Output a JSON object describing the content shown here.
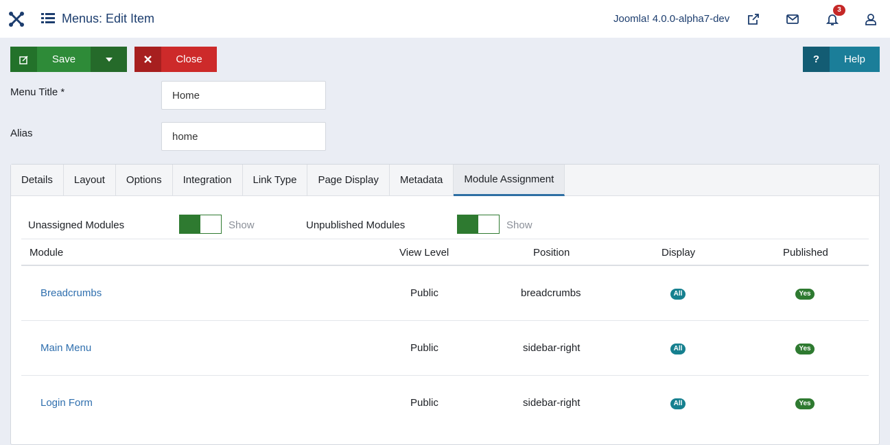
{
  "header": {
    "title": "Menus: Edit Item",
    "version": "Joomla! 4.0.0-alpha7-dev",
    "notification_count": "3",
    "icons": [
      "joomla-logo",
      "menu-list-icon",
      "external-link-icon",
      "mail-icon",
      "bell-icon",
      "user-icon"
    ]
  },
  "toolbar": {
    "save_label": "Save",
    "close_label": "Close",
    "help_label": "Help",
    "help_icon": "?",
    "colors": {
      "save": "#2e8b38",
      "close": "#cd2a2a",
      "help": "#1b7e99"
    }
  },
  "form": {
    "menu_title_label": "Menu Title *",
    "menu_title_value": "Home",
    "alias_label": "Alias",
    "alias_value": "home"
  },
  "tabs": [
    "Details",
    "Layout",
    "Options",
    "Integration",
    "Link Type",
    "Page Display",
    "Metadata",
    "Module Assignment"
  ],
  "active_tab": "Module Assignment",
  "filters": {
    "unassigned_label": "Unassigned Modules",
    "unassigned_state": "Show",
    "unpublished_label": "Unpublished Modules",
    "unpublished_state": "Show"
  },
  "table": {
    "columns": [
      "Module",
      "View Level",
      "Position",
      "Display",
      "Published"
    ],
    "rows": [
      {
        "module": "Breadcrumbs",
        "view_level": "Public",
        "position": "breadcrumbs",
        "display": "All",
        "published": "Yes"
      },
      {
        "module": "Main Menu",
        "view_level": "Public",
        "position": "sidebar-right",
        "display": "All",
        "published": "Yes"
      },
      {
        "module": "Login Form",
        "view_level": "Public",
        "position": "sidebar-right",
        "display": "All",
        "published": "Yes"
      }
    ]
  }
}
